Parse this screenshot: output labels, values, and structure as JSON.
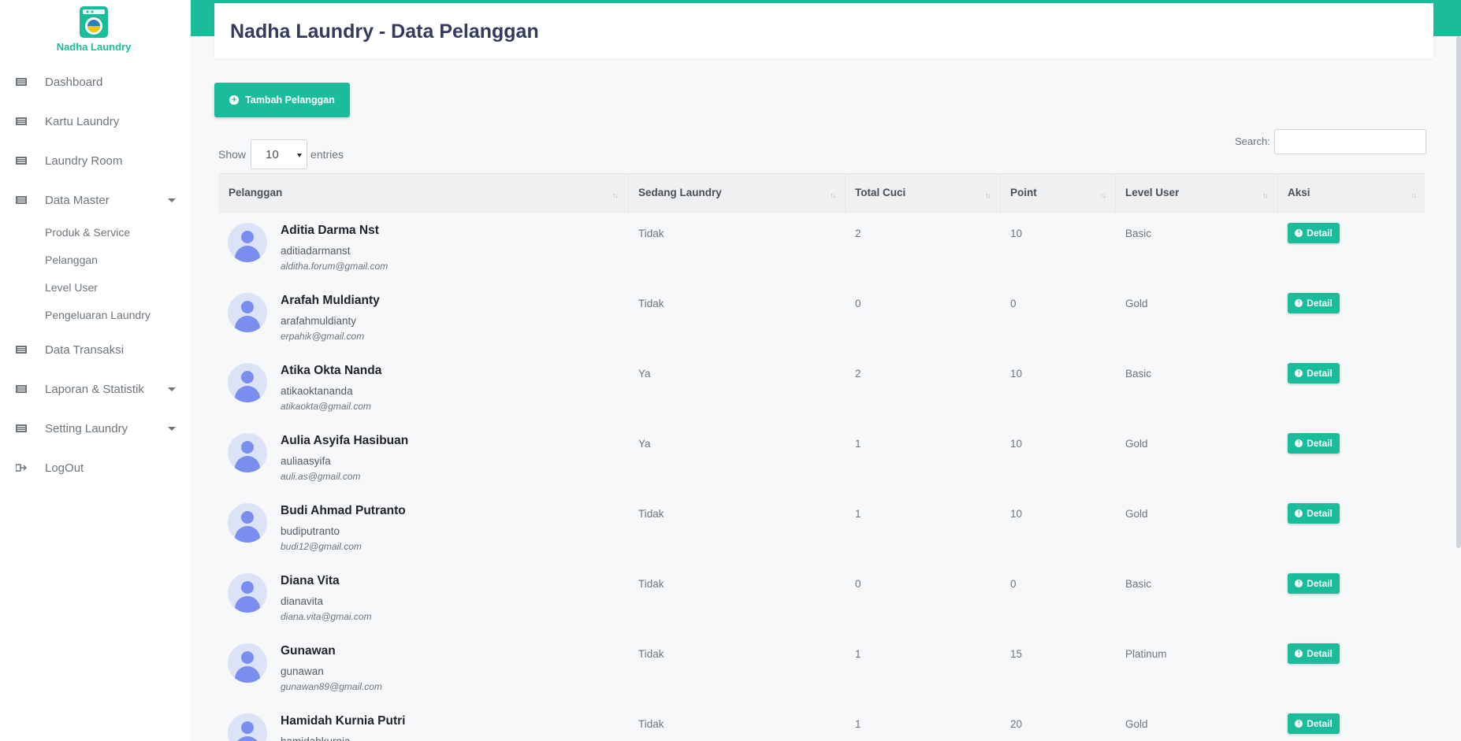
{
  "app": {
    "name": "Nadha Laundry"
  },
  "sidebar": {
    "items": [
      {
        "label": "Dashboard"
      },
      {
        "label": "Kartu Laundry"
      },
      {
        "label": "Laundry Room"
      },
      {
        "label": "Data Master"
      },
      {
        "label": "Data Transaksi"
      },
      {
        "label": "Laporan & Statistik"
      },
      {
        "label": "Setting Laundry"
      },
      {
        "label": "LogOut"
      }
    ],
    "sub_items": [
      {
        "label": "Produk & Service"
      },
      {
        "label": "Pelanggan"
      },
      {
        "label": "Level User"
      },
      {
        "label": "Pengeluaran Laundry"
      }
    ]
  },
  "header": {
    "title": "Nadha Laundry - Data Pelanggan"
  },
  "actions": {
    "add_label": "Tambah Pelanggan"
  },
  "table_controls": {
    "show_label": "Show",
    "entries_value": "10",
    "entries_label": "entries",
    "search_label": "Search:"
  },
  "table": {
    "columns": [
      "Pelanggan",
      "Sedang Laundry",
      "Total Cuci",
      "Point",
      "Level User",
      "Aksi"
    ],
    "detail_label": "Detail",
    "rows": [
      {
        "name": "Aditia Darma Nst",
        "username": "aditiadarmanst",
        "email": "alditha.forum@gmail.com",
        "sedang": "Tidak",
        "total": "2",
        "point": "10",
        "level": "Basic"
      },
      {
        "name": "Arafah Muldianty",
        "username": "arafahmuldianty",
        "email": "erpahik@gmail.com",
        "sedang": "Tidak",
        "total": "0",
        "point": "0",
        "level": "Gold"
      },
      {
        "name": "Atika Okta Nanda",
        "username": "atikaoktananda",
        "email": "atikaokta@gmail.com",
        "sedang": "Ya",
        "total": "2",
        "point": "10",
        "level": "Basic"
      },
      {
        "name": "Aulia Asyifa Hasibuan",
        "username": "auliaasyifa",
        "email": "auli.as@gmail.com",
        "sedang": "Ya",
        "total": "1",
        "point": "10",
        "level": "Gold"
      },
      {
        "name": "Budi Ahmad Putranto",
        "username": "budiputranto",
        "email": "budi12@gmail.com",
        "sedang": "Tidak",
        "total": "1",
        "point": "10",
        "level": "Gold"
      },
      {
        "name": "Diana Vita",
        "username": "dianavita",
        "email": "diana.vita@gmai.com",
        "sedang": "Tidak",
        "total": "0",
        "point": "0",
        "level": "Basic"
      },
      {
        "name": "Gunawan",
        "username": "gunawan",
        "email": "gunawan89@gmail.com",
        "sedang": "Tidak",
        "total": "1",
        "point": "15",
        "level": "Platinum"
      },
      {
        "name": "Hamidah Kurnia Putri",
        "username": "hamidahkurnia",
        "email": "",
        "sedang": "Tidak",
        "total": "1",
        "point": "20",
        "level": "Gold"
      }
    ]
  },
  "colors": {
    "accent": "#1abc9c",
    "avatar": "#7a8ef0"
  }
}
